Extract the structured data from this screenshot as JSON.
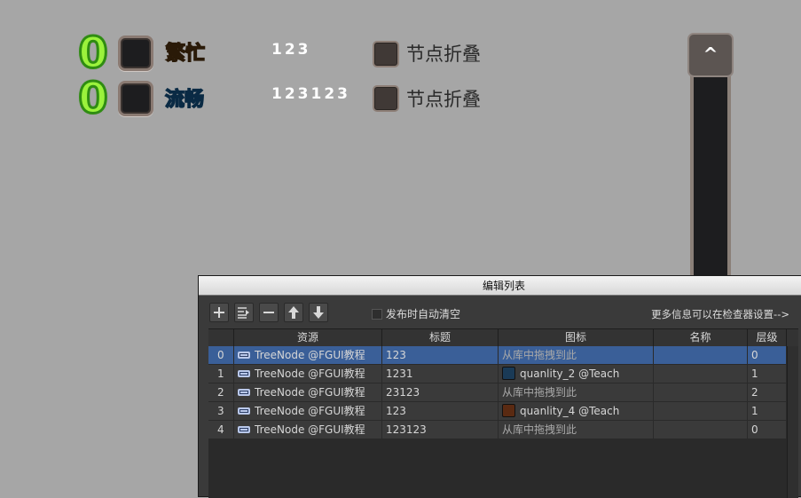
{
  "canvas": {
    "rows": [
      {
        "zero": "0",
        "tag": "繁忙",
        "number": "123",
        "toggle_label": "节点折叠"
      },
      {
        "zero": "0",
        "tag": "流畅",
        "number": "123123",
        "toggle_label": "节点折叠"
      }
    ],
    "scroll_up_glyph": "^"
  },
  "panel": {
    "title": "编辑列表",
    "autoclear_label": "发布时自动清空",
    "more_info": "更多信息可以在检查器设置-->",
    "columns": [
      "资源",
      "标题",
      "图标",
      "名称",
      "层级"
    ],
    "rows": [
      {
        "index": "0",
        "resource": "TreeNode @FGUI教程",
        "title": "123",
        "icon": "从库中拖拽到此",
        "icon_thumb": "",
        "name": "",
        "level": "0"
      },
      {
        "index": "1",
        "resource": "TreeNode @FGUI教程",
        "title": "1231",
        "icon": "quanlity_2 @Teach",
        "icon_thumb": "#1a3a56",
        "name": "",
        "level": "1"
      },
      {
        "index": "2",
        "resource": "TreeNode @FGUI教程",
        "title": "23123",
        "icon": "从库中拖拽到此",
        "icon_thumb": "",
        "name": "",
        "level": "2"
      },
      {
        "index": "3",
        "resource": "TreeNode @FGUI教程",
        "title": "123",
        "icon": "quanlity_4 @Teach",
        "icon_thumb": "#5a2a12",
        "name": "",
        "level": "1"
      },
      {
        "index": "4",
        "resource": "TreeNode @FGUI教程",
        "title": "123123",
        "icon": "从库中拖拽到此",
        "icon_thumb": "",
        "name": "",
        "level": "0"
      }
    ],
    "selected_row": 0
  },
  "icons": [
    "plus-icon",
    "insert-icon",
    "minus-icon",
    "arrow-up-icon",
    "arrow-down-icon",
    "tree-node-icon"
  ]
}
